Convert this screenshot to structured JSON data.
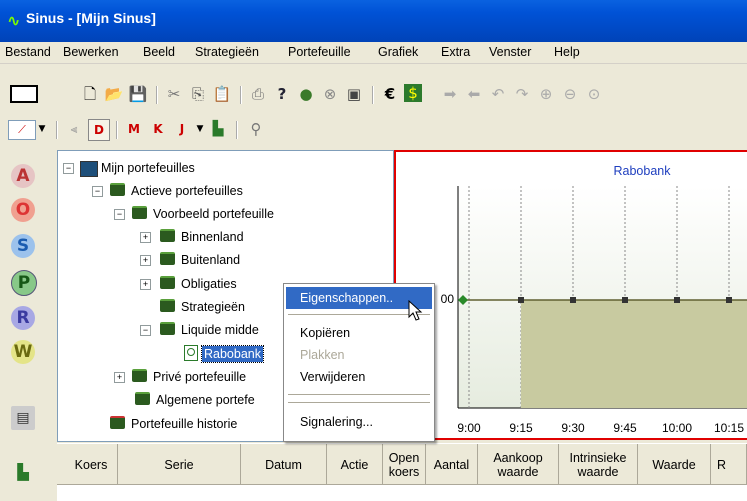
{
  "window": {
    "title": "Sinus - [Mijn Sinus]",
    "logo_glyph": "∿"
  },
  "menu": [
    "Bestand",
    "Bewerken",
    "Beeld",
    "Strategieën",
    "Portefeuille",
    "Grafiek",
    "Extra",
    "Venster",
    "Help"
  ],
  "toolbar": {
    "currency_symbol": "€"
  },
  "tree": {
    "root": "Mijn portefeuilles",
    "active": "Actieve portefeuilles",
    "example": "Voorbeeld portefeuille",
    "binnenland": "Binnenland",
    "buitenland": "Buitenland",
    "obligaties": "Obligaties",
    "strategieen": "Strategieën",
    "liquide": "Liquide midde",
    "rabobank": "Rabobank",
    "prive": "Privé portefeuille",
    "algemene": "Algemene portefe",
    "historie": "Portefeuille historie"
  },
  "context_menu": {
    "items": [
      {
        "label": "Eigenschappen..",
        "state": "selected"
      },
      {
        "label": "Kopiëren",
        "state": "normal"
      },
      {
        "label": "Plakken",
        "state": "disabled"
      },
      {
        "label": "Verwijderen",
        "state": "normal"
      },
      {
        "label": "Signalering...",
        "state": "normal"
      }
    ]
  },
  "table": {
    "headers": [
      "Koers",
      "Serie",
      "Datum",
      "Actie",
      "Open koers",
      "Aantal",
      "Aankoop waarde",
      "Intrinsieke waarde",
      "Waarde",
      "R"
    ]
  },
  "chart_data": {
    "type": "line",
    "title": "Rabobank",
    "y_partial_label": "00",
    "x_labels": [
      "9:00",
      "9:15",
      "9:30",
      "9:45",
      "10:00",
      "10:15"
    ],
    "marker_color": "#2a8a2a",
    "area_color": "#c8caa0",
    "line_color": "#606030"
  }
}
